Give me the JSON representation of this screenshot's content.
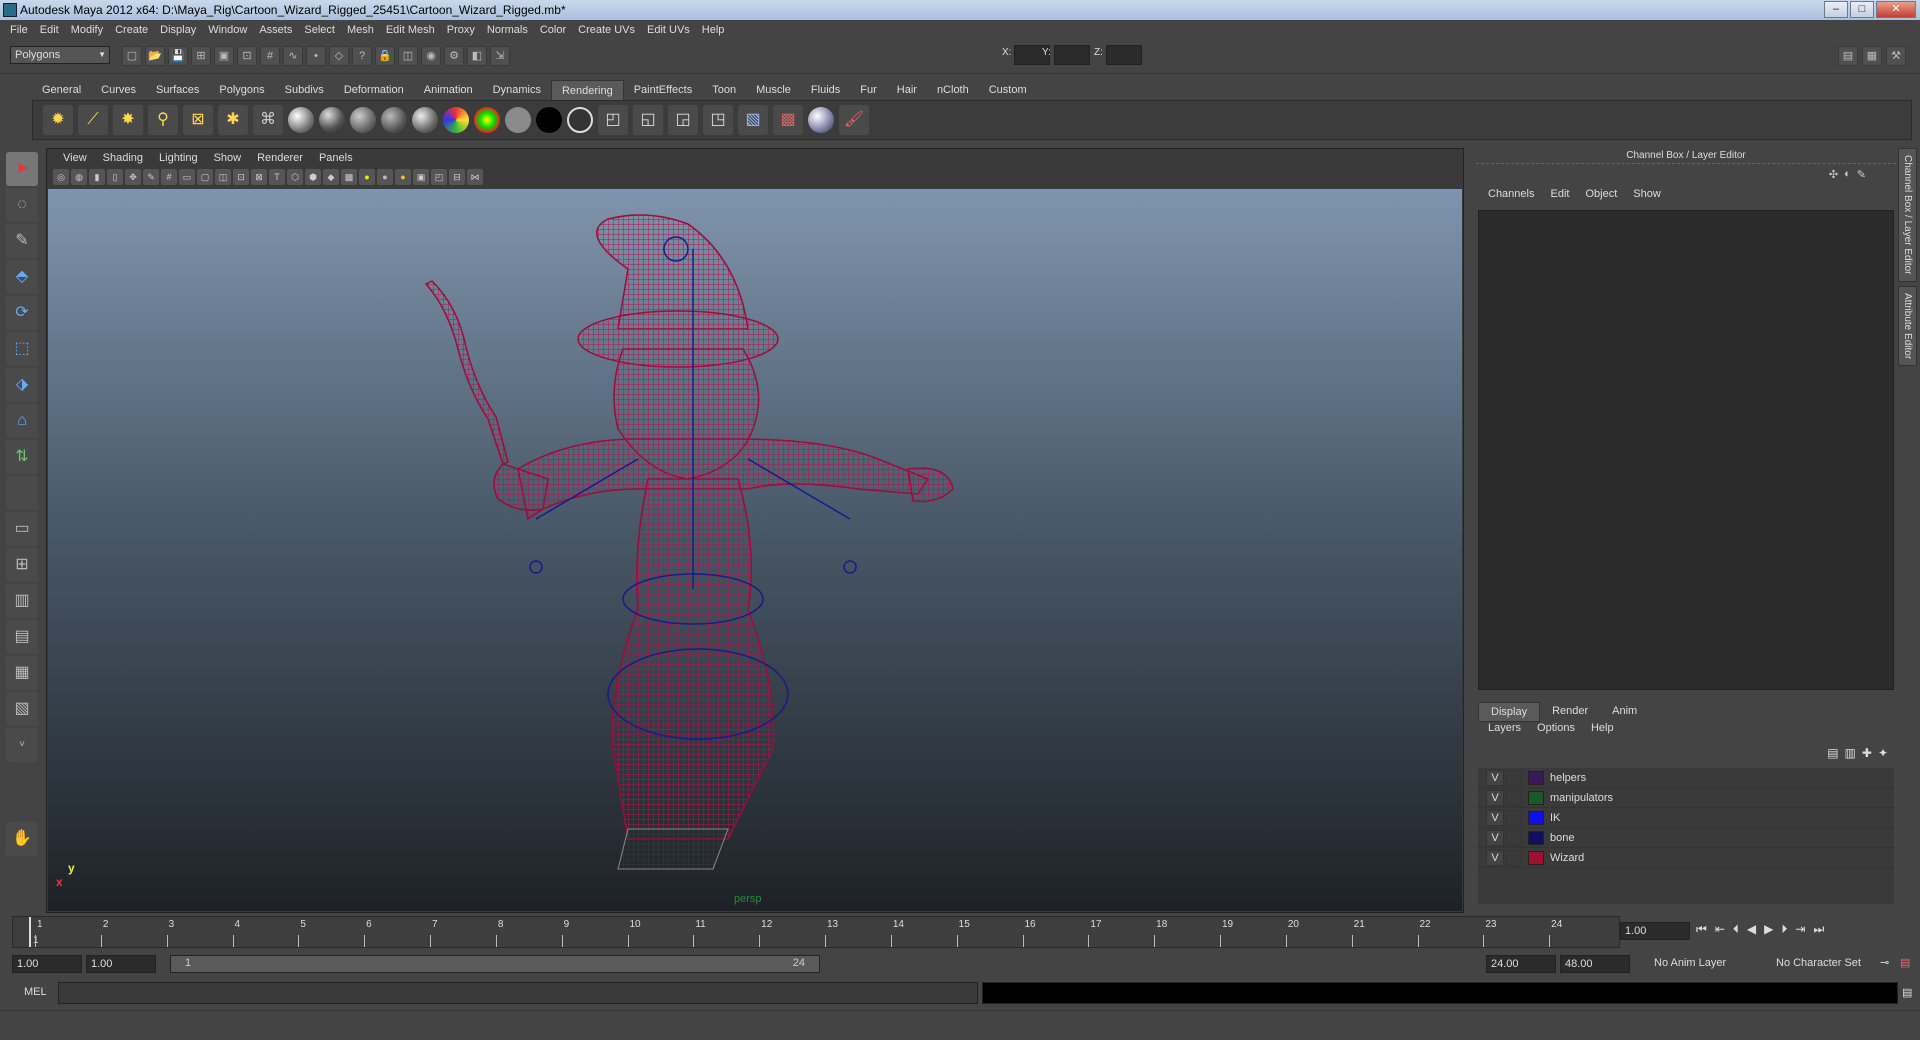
{
  "window": {
    "title": "Autodesk Maya 2012 x64: D:\\Maya_Rig\\Cartoon_Wizard_Rigged_25451\\Cartoon_Wizard_Rigged.mb*"
  },
  "menus": [
    "File",
    "Edit",
    "Modify",
    "Create",
    "Display",
    "Window",
    "Assets",
    "Select",
    "Mesh",
    "Edit Mesh",
    "Proxy",
    "Normals",
    "Color",
    "Create UVs",
    "Edit UVs",
    "Help"
  ],
  "status": {
    "mode": "Polygons",
    "x_label": "X:",
    "y_label": "Y:",
    "z_label": "Z:"
  },
  "shelf_tabs": [
    "General",
    "Curves",
    "Surfaces",
    "Polygons",
    "Subdivs",
    "Deformation",
    "Animation",
    "Dynamics",
    "Rendering",
    "PaintEffects",
    "Toon",
    "Muscle",
    "Fluids",
    "Fur",
    "Hair",
    "nCloth",
    "Custom"
  ],
  "active_shelf": "Rendering",
  "panel_menu": [
    "View",
    "Shading",
    "Lighting",
    "Show",
    "Renderer",
    "Panels"
  ],
  "viewport": {
    "camera": "persp",
    "axis_x": "x",
    "axis_y": "y"
  },
  "channel_box": {
    "title": "Channel Box / Layer Editor",
    "menu": [
      "Channels",
      "Edit",
      "Object",
      "Show"
    ]
  },
  "side_tabs": [
    "Channel Box / Layer Editor",
    "Attribute Editor"
  ],
  "layer_editor": {
    "tabs": [
      "Display",
      "Render",
      "Anim"
    ],
    "menu": [
      "Layers",
      "Options",
      "Help"
    ],
    "layers": [
      {
        "vis": "V",
        "name": "helpers",
        "color": "#3a1a55"
      },
      {
        "vis": "V",
        "name": "manipulators",
        "color": "#1a5a2a"
      },
      {
        "vis": "V",
        "name": "IK",
        "color": "#1010ee"
      },
      {
        "vis": "V",
        "name": "bone",
        "color": "#101060"
      },
      {
        "vis": "V",
        "name": "Wizard",
        "color": "#a01030"
      }
    ]
  },
  "timeline": {
    "ticks": [
      "1",
      "2",
      "3",
      "4",
      "5",
      "6",
      "7",
      "8",
      "9",
      "10",
      "11",
      "12",
      "13",
      "14",
      "15",
      "16",
      "17",
      "18",
      "19",
      "20",
      "21",
      "22",
      "23",
      "24"
    ],
    "current_marker": "1",
    "current_frame": "1.00"
  },
  "range": {
    "start": "1.00",
    "playback_start": "1.00",
    "slider_start": "1",
    "slider_end": "24",
    "playback_end": "24.00",
    "end": "48.00",
    "anim_layer": "No Anim Layer",
    "char_set": "No Character Set"
  },
  "command": {
    "label": "MEL"
  }
}
